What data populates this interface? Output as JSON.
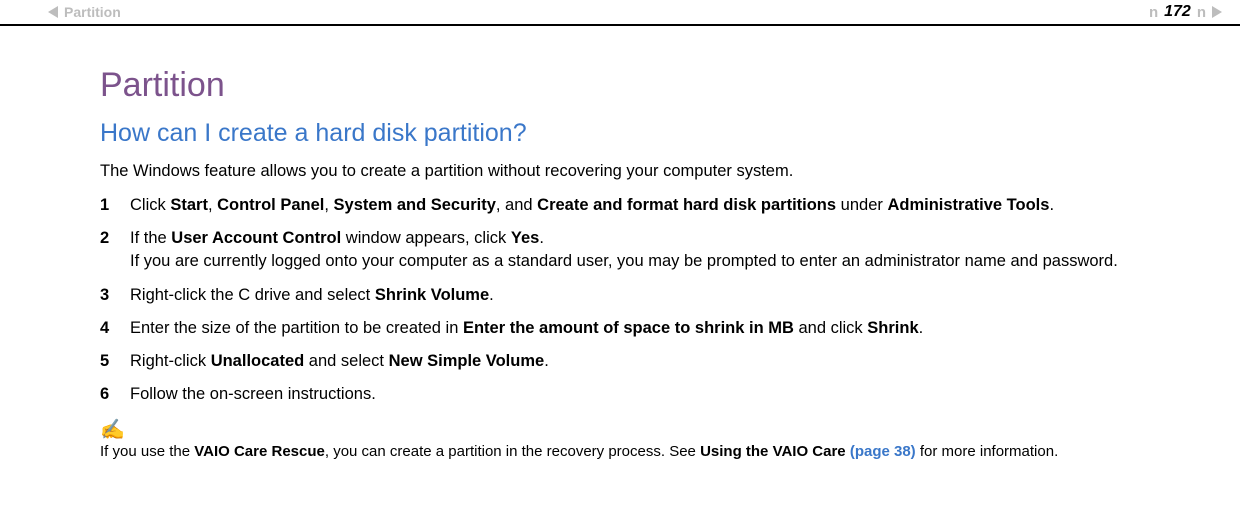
{
  "header": {
    "breadcrumb": "Partition",
    "n_letter": "n",
    "page_number": "172"
  },
  "content": {
    "title": "Partition",
    "question": "How can I create a hard disk partition?",
    "intro": "The Windows feature allows you to create a partition without recovering your computer system.",
    "steps": {
      "s1": {
        "t1": "Click ",
        "b1": "Start",
        "t2": ", ",
        "b2": "Control Panel",
        "t3": ", ",
        "b3": "System and Security",
        "t4": ", and ",
        "b4": "Create and format hard disk partitions",
        "t5": " under ",
        "b5": "Administrative Tools",
        "t6": "."
      },
      "s2": {
        "t1": "If the ",
        "b1": "User Account Control",
        "t2": " window appears, click ",
        "b2": "Yes",
        "t3": ".",
        "line2": "If you are currently logged onto your computer as a standard user, you may be prompted to enter an administrator name and password."
      },
      "s3": {
        "t1": "Right-click the C drive and select ",
        "b1": "Shrink Volume",
        "t2": "."
      },
      "s4": {
        "t1": "Enter the size of the partition to be created in ",
        "b1": "Enter the amount of space to shrink in MB",
        "t2": " and click ",
        "b2": "Shrink",
        "t3": "."
      },
      "s5": {
        "t1": "Right-click ",
        "b1": "Unallocated",
        "t2": " and select ",
        "b2": "New Simple Volume",
        "t3": "."
      },
      "s6": {
        "t1": "Follow the on-screen instructions."
      }
    },
    "note": {
      "icon": "✍",
      "t1": "If you use the ",
      "b1": "VAIO Care Rescue",
      "t2": ", you can create a partition in the recovery process. See ",
      "b2": "Using the VAIO Care",
      "xref": " (page 38)",
      "t3": " for more information."
    }
  }
}
